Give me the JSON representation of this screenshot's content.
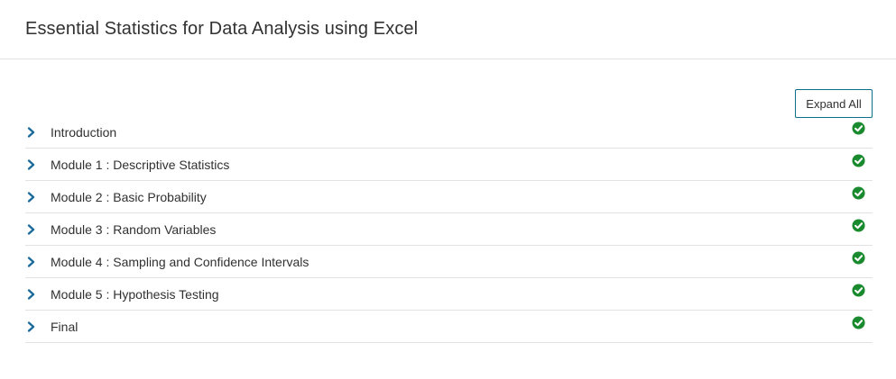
{
  "course": {
    "title": "Essential Statistics for Data Analysis using Excel"
  },
  "toolbar": {
    "expand_all_label": "Expand All"
  },
  "sections": [
    {
      "label": "Introduction",
      "completed": true
    },
    {
      "label": "Module 1 : Descriptive Statistics",
      "completed": true
    },
    {
      "label": "Module 2 : Basic Probability",
      "completed": true
    },
    {
      "label": "Module 3 : Random Variables",
      "completed": true
    },
    {
      "label": "Module 4 : Sampling and Confidence Intervals",
      "completed": true
    },
    {
      "label": "Module 5 : Hypothesis Testing",
      "completed": true
    },
    {
      "label": "Final",
      "completed": true
    }
  ],
  "colors": {
    "accent": "#0a6e8c",
    "chevron": "#1b6b9a",
    "complete": "#1a8a2e",
    "divider": "#e2e2e2"
  },
  "icons": {
    "expand": "chevron-right-icon",
    "status": "check-circle-icon"
  }
}
